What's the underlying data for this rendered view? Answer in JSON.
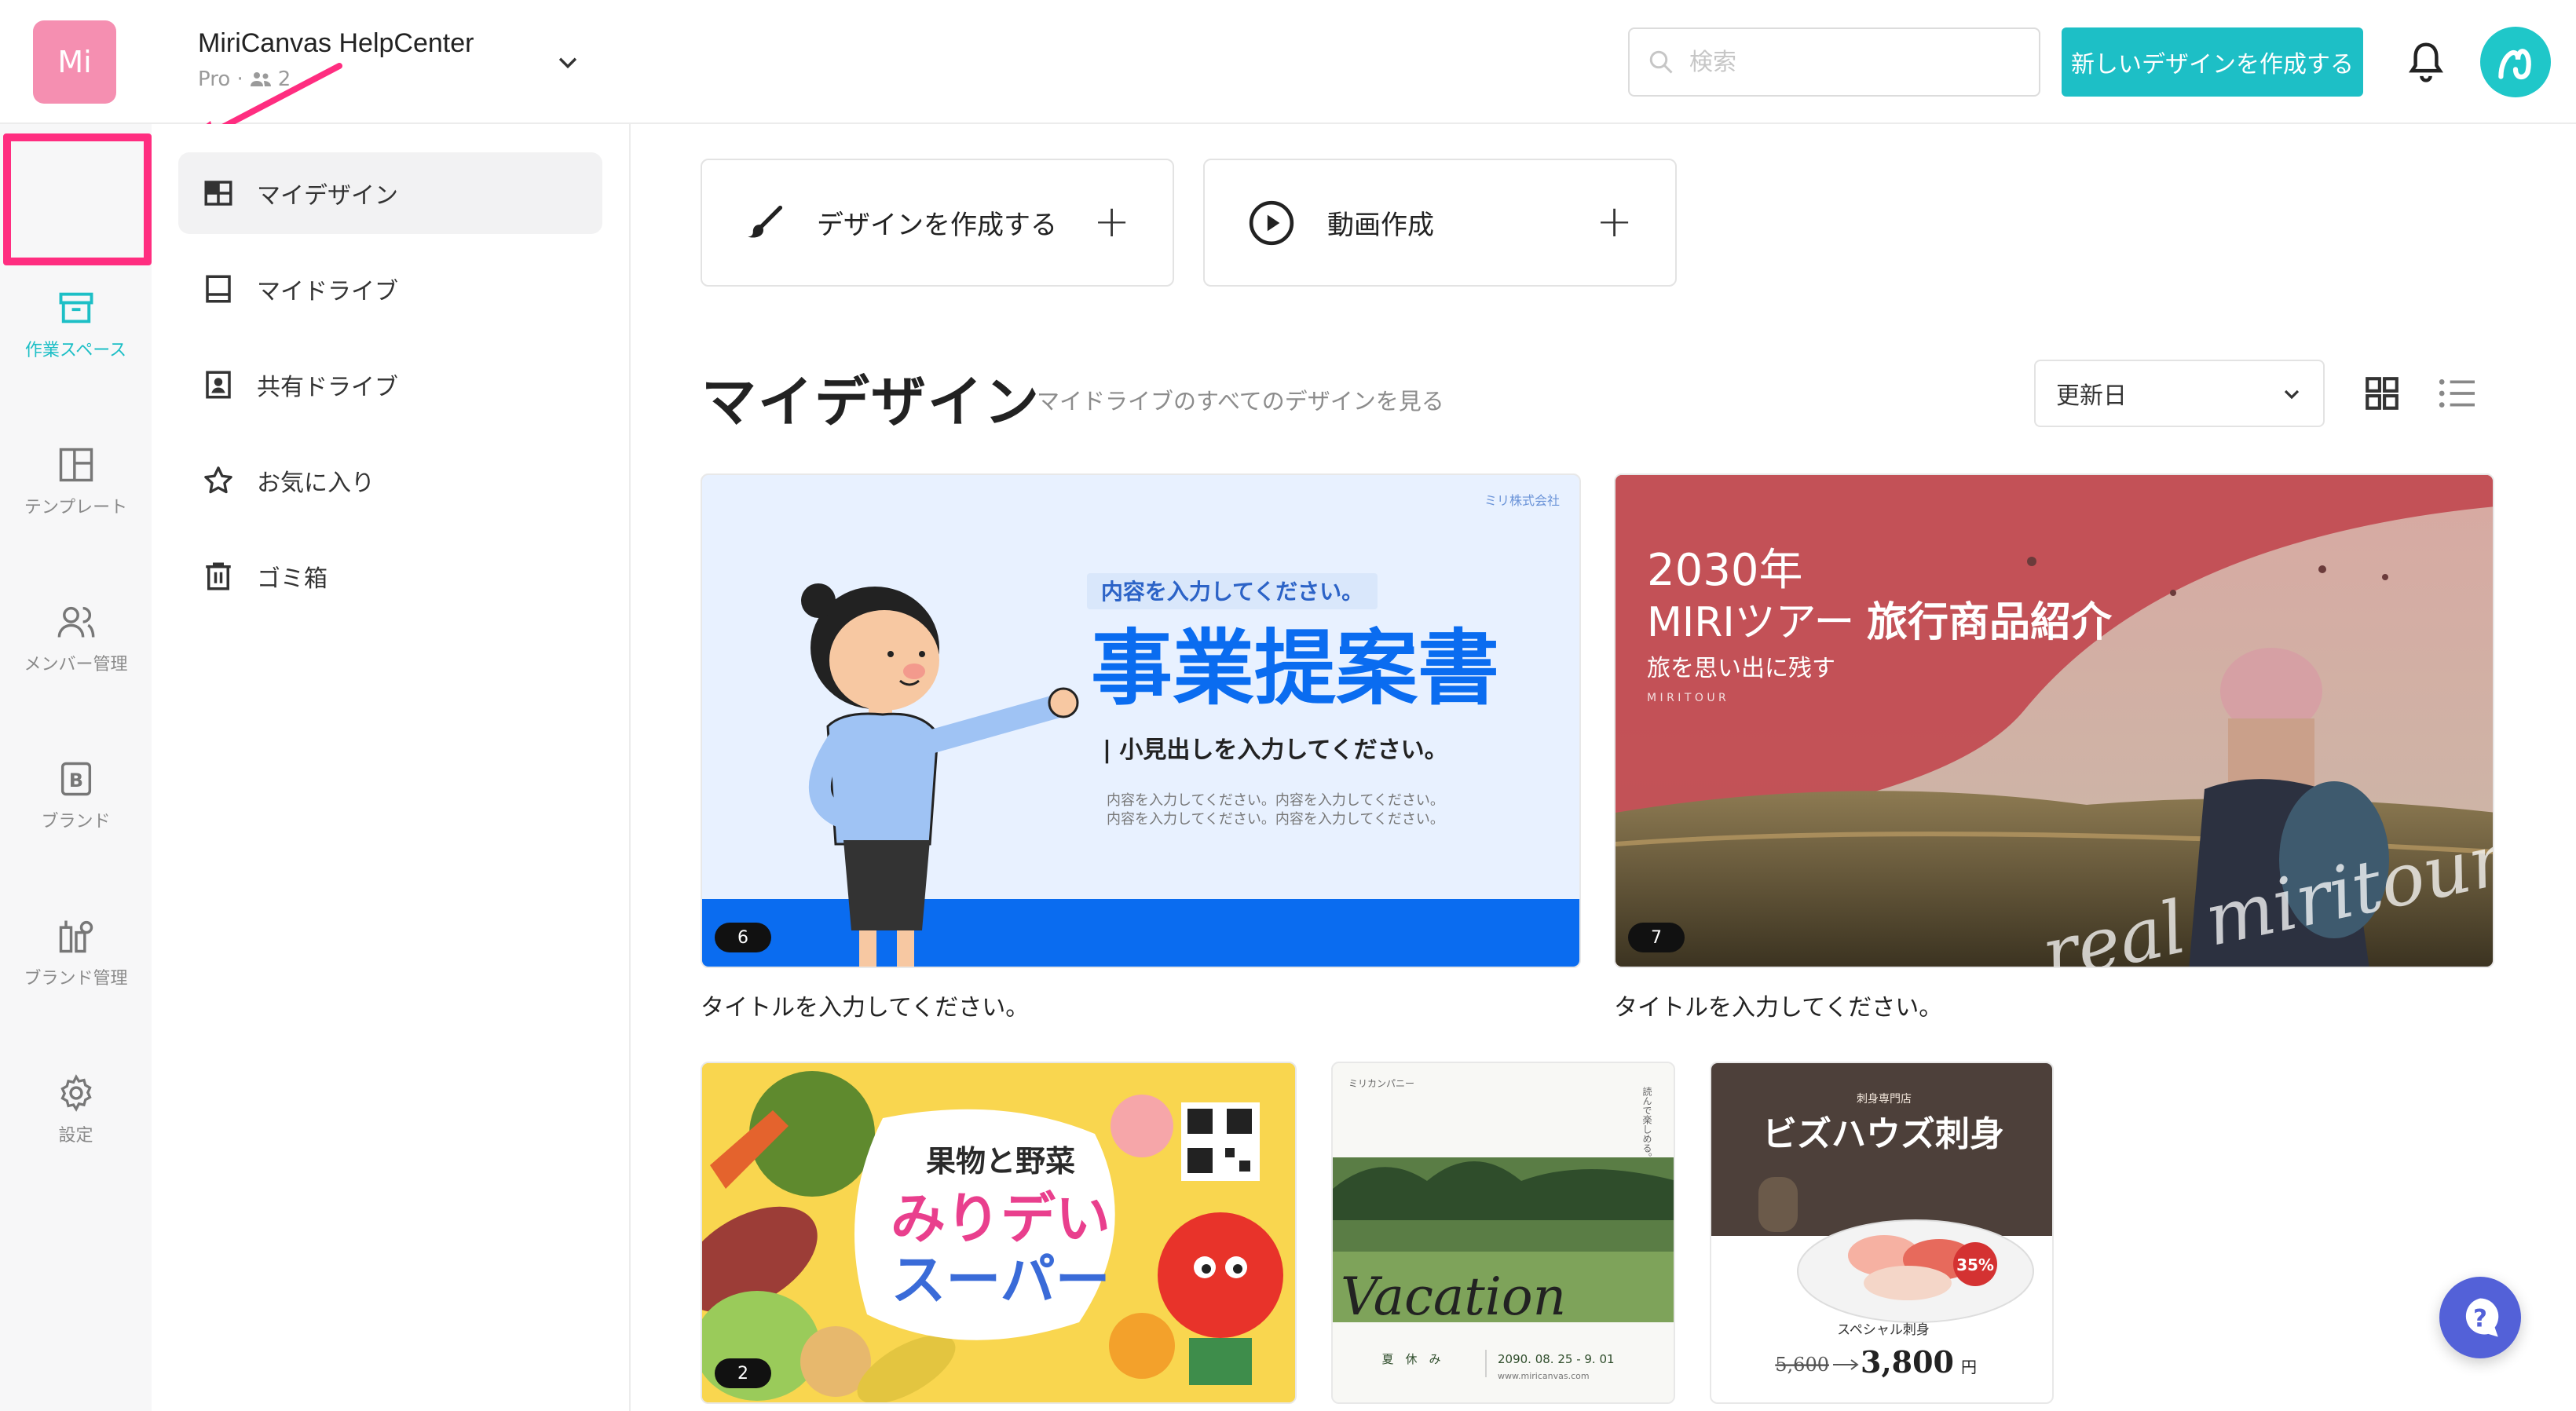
{
  "header": {
    "team_avatar": "Mi",
    "team_name": "MiriCanvas HelpCenter",
    "team_plan": "Pro ·",
    "team_members": "2",
    "search_placeholder": "検索",
    "create_button": "新しいデザインを作成する"
  },
  "rail": {
    "items": [
      {
        "label": "作業スペース",
        "icon": "archive-icon"
      },
      {
        "label": "テンプレート",
        "icon": "layout-icon"
      },
      {
        "label": "メンバー管理",
        "icon": "users-icon"
      },
      {
        "label": "ブランド",
        "icon": "brand-icon"
      },
      {
        "label": "ブランド管理",
        "icon": "brand-manage-icon"
      },
      {
        "label": "設定",
        "icon": "gear-icon"
      }
    ],
    "collapse": "«"
  },
  "nav": {
    "items": [
      {
        "label": "マイデザイン",
        "icon": "grid-icon"
      },
      {
        "label": "マイドライブ",
        "icon": "drive-icon"
      },
      {
        "label": "共有ドライブ",
        "icon": "shared-drive-icon"
      },
      {
        "label": "お気に入り",
        "icon": "star-icon"
      },
      {
        "label": "ゴミ箱",
        "icon": "trash-icon"
      }
    ]
  },
  "quick_actions": {
    "design": "デザインを作成する",
    "video": "動画作成"
  },
  "section": {
    "title": "マイデザイン",
    "link": "マイドライブのすべてのデザインを見る",
    "sort": "更新日"
  },
  "cards": [
    {
      "badge": "6",
      "title": "タイトルを入力してください。",
      "company": "ミリ株式会社",
      "kicker": "内容を入力してください。",
      "headline": "事業提案書",
      "sub": "| 小見出しを入力してください。",
      "body1": "内容を入力してください。内容を入力してください。",
      "body2": "内容を入力してください。内容を入力してください。"
    },
    {
      "badge": "7",
      "title": "タイトルを入力してください。",
      "line1": "2030年",
      "line2a": "MIRIツアー",
      "line2b": "旅行商品紹介",
      "line3": "旅を思い出に残す",
      "line4": "M I R I T O U R",
      "script": "real miritour"
    },
    {
      "badge": "2",
      "line1": "果物と野菜",
      "line2": "みりデい",
      "line3": "スーパー"
    },
    {
      "brand": "ミリカンパニー",
      "vertical": "読んで楽しめる。",
      "script": "Vacation",
      "foot1": "夏　休　み",
      "foot2": "2090. 08. 25 - 9. 01",
      "foot3": "www.miricanvas.com"
    },
    {
      "shop": "刺身専門店",
      "name": "ビズハウズ刺身",
      "special": "スペシャル刺身",
      "old_price": "5,600",
      "new_price": "3,800",
      "yen": "円",
      "badge": "35%"
    }
  ],
  "colors": {
    "accent": "#1dbfc6",
    "highlight": "#ff2d80",
    "team_avatar": "#f58fb1",
    "help": "#5361d8"
  }
}
